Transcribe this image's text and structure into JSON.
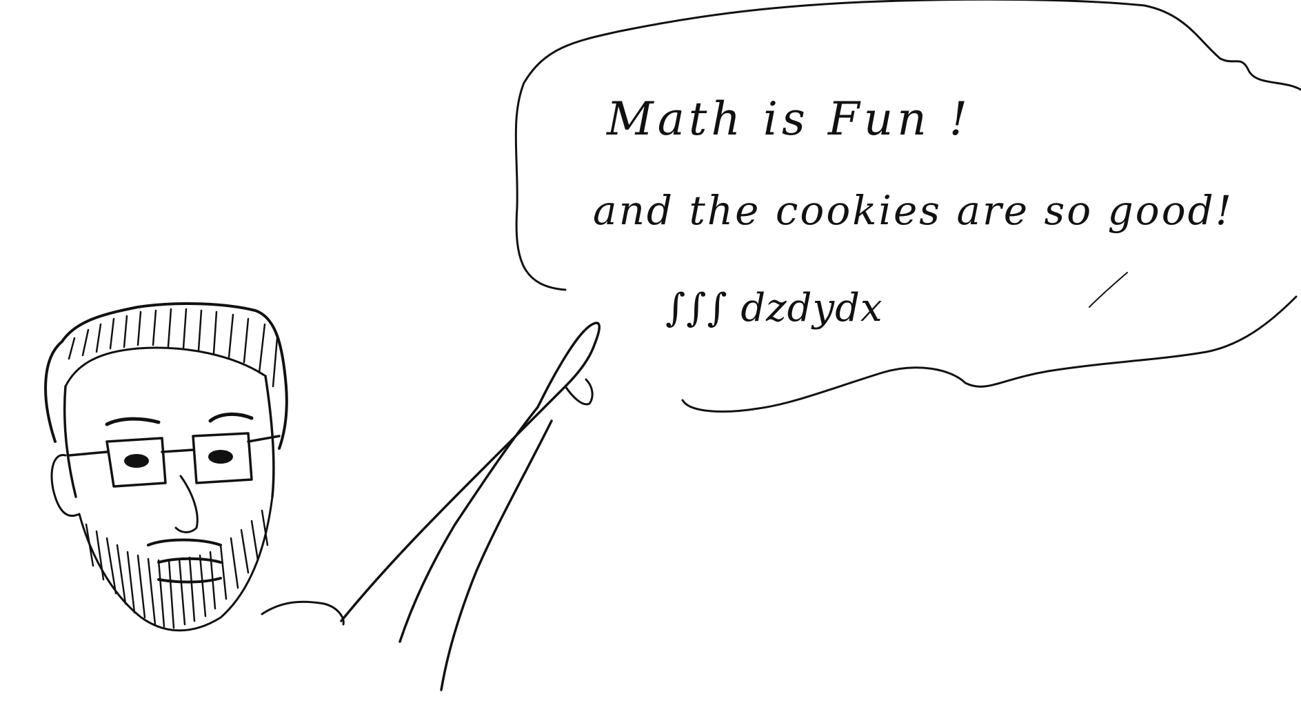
{
  "drawing": {
    "speech_bubble": {
      "line_1": "Math is Fun !",
      "line_2": "and the cookies are so good!",
      "line_3": "∫∫∫ dzdydx"
    },
    "ink_color": "#111111",
    "paper_color": "#ffffff"
  }
}
